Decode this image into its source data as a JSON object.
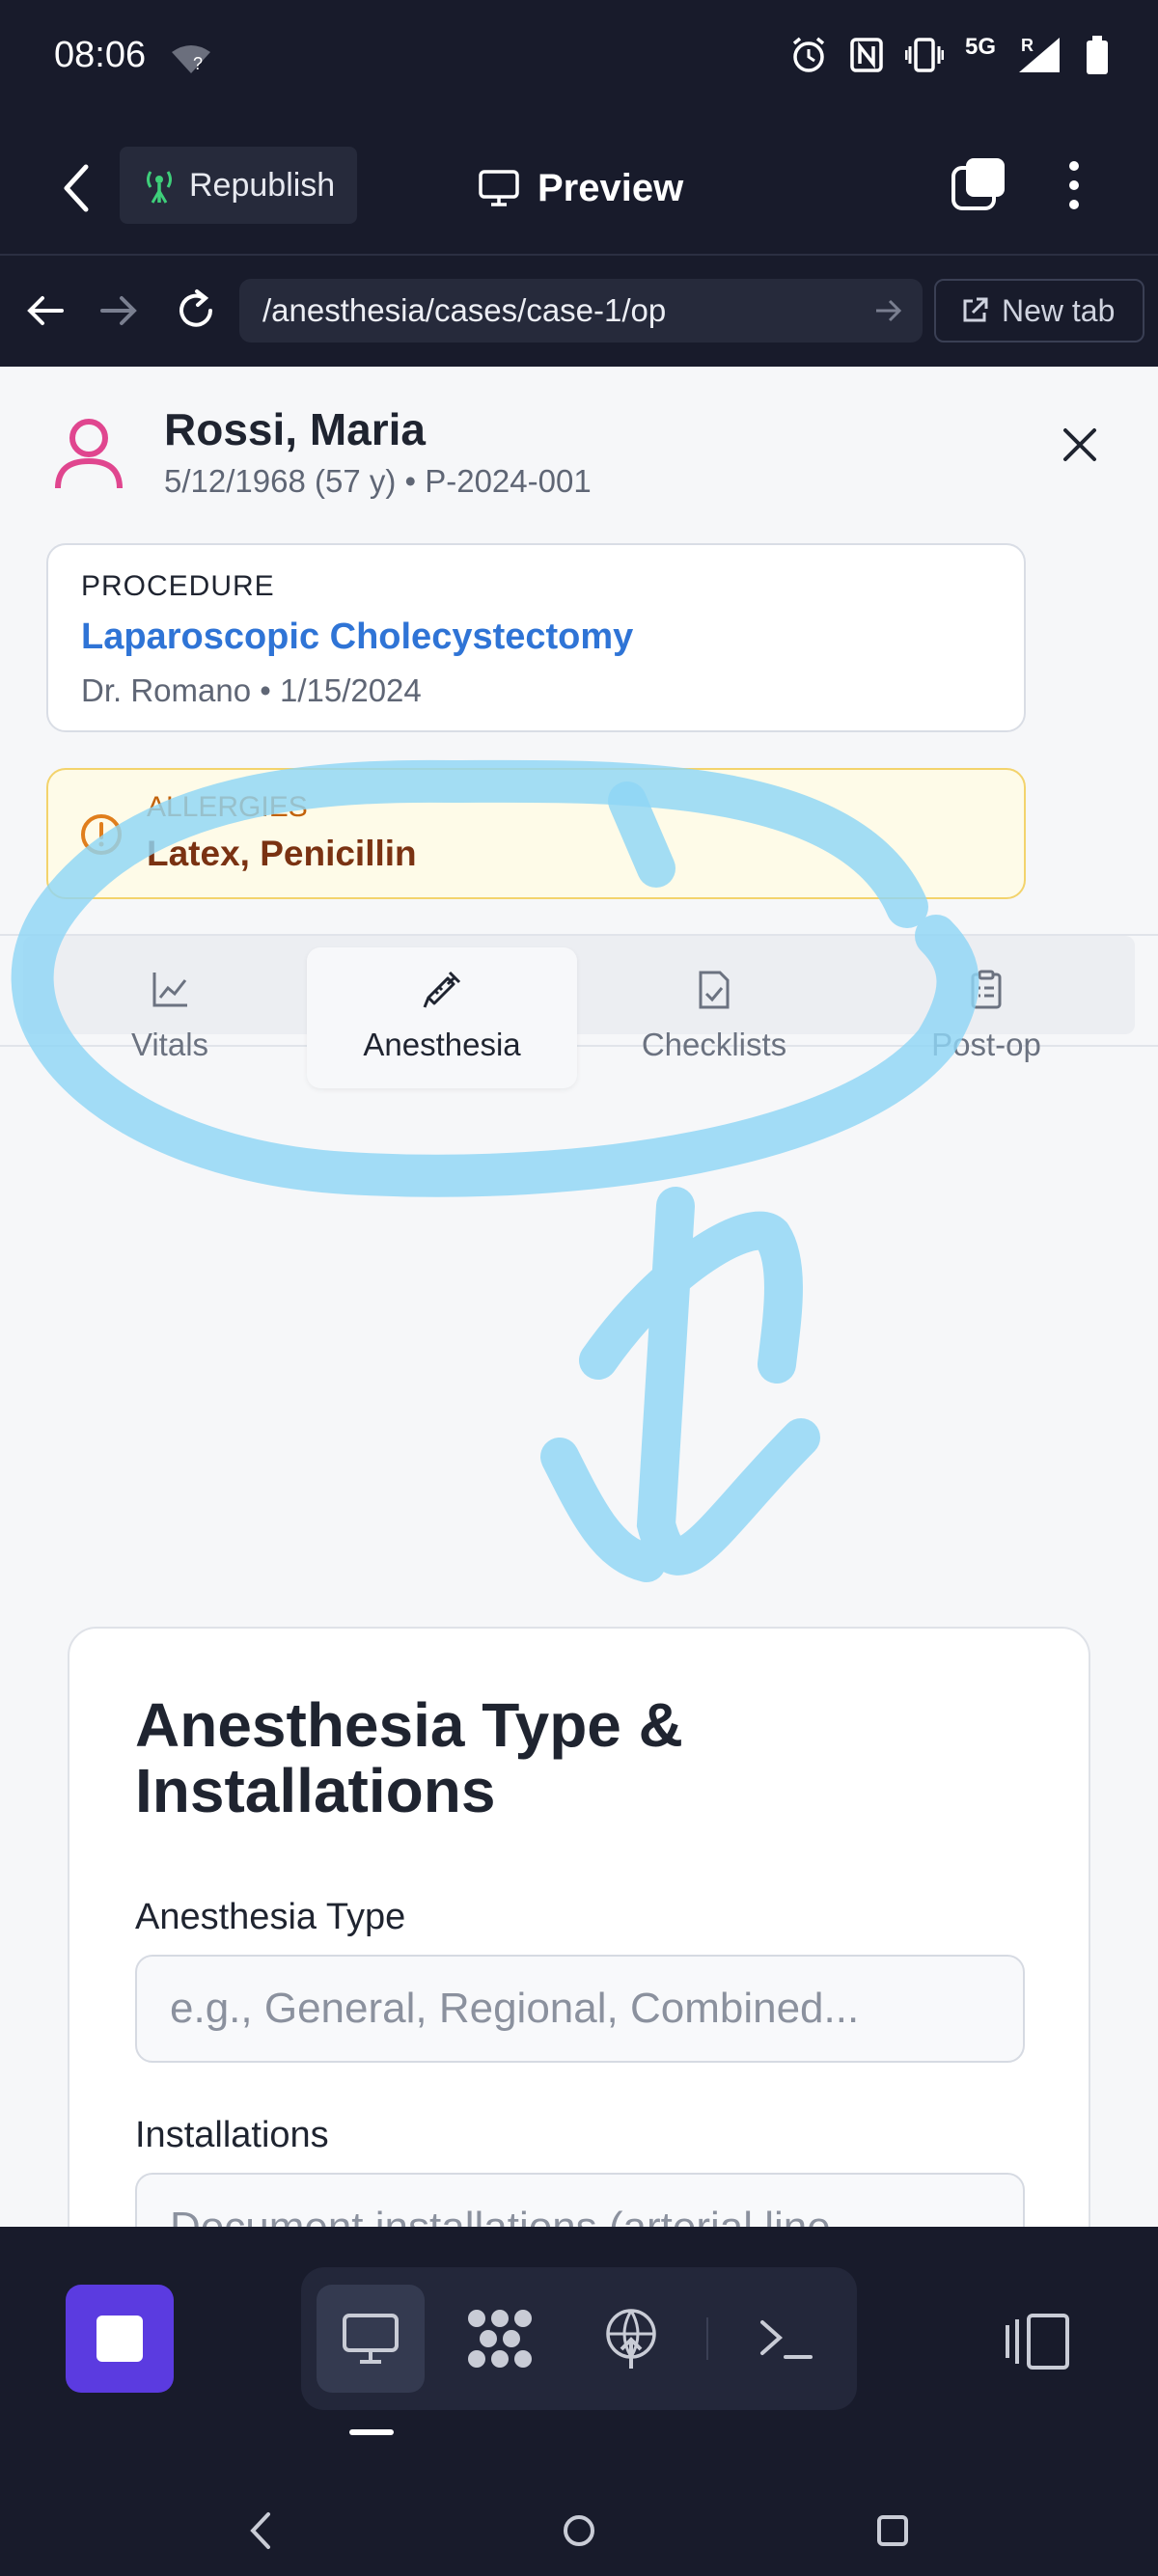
{
  "status_bar": {
    "time": "08:06",
    "network": "5G",
    "roaming": "R"
  },
  "toolbar": {
    "republish_label": "Republish",
    "preview_label": "Preview"
  },
  "url_bar": {
    "url": "/anesthesia/cases/case-1/op",
    "new_tab_label": "New tab"
  },
  "patient": {
    "name": "Rossi, Maria",
    "meta": "5/12/1968 (57 y) • P-2024-001"
  },
  "procedure": {
    "label": "PROCEDURE",
    "title": "Laparoscopic Cholecystectomy",
    "meta": "Dr. Romano • 1/15/2024"
  },
  "allergies": {
    "label": "ALLERGIES",
    "value": "Latex, Penicillin"
  },
  "tabs": [
    {
      "label": "Vitals",
      "icon": "chart-line-icon"
    },
    {
      "label": "Anesthesia",
      "icon": "syringe-icon",
      "active": true
    },
    {
      "label": "Checklists",
      "icon": "file-check-icon"
    },
    {
      "label": "Post-op",
      "icon": "clipboard-list-icon"
    }
  ],
  "form": {
    "title": "Anesthesia Type & Installations",
    "type_label": "Anesthesia Type",
    "type_placeholder": "e.g., General, Regional, Combined...",
    "installations_label": "Installations",
    "installations_placeholder": "Document installations (arterial line,"
  },
  "colors": {
    "accent_purple": "#5b3be0",
    "link_blue": "#2f74d6",
    "allergy_bg": "#fefbe8",
    "allergy_text": "#7a3212",
    "annotation_stroke": "#8fd5f5"
  }
}
